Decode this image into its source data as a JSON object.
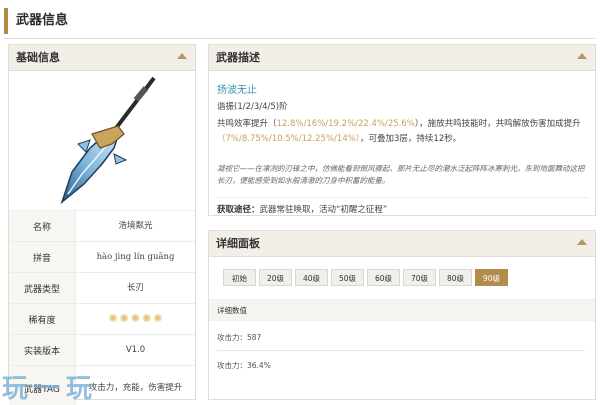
{
  "page": {
    "title": "武器信息"
  },
  "left_panel": {
    "header": "基础信息",
    "rows": [
      {
        "key": "名称",
        "value": "浩境粼光"
      },
      {
        "key": "拼音",
        "value": "hào jìng lín guāng"
      },
      {
        "key": "武器类型",
        "value": "长刃"
      },
      {
        "key": "稀有度",
        "stars": 5
      },
      {
        "key": "实装版本",
        "value": "V1.0"
      },
      {
        "key": "武器TAG",
        "value": "攻击力，充能，伤害提升"
      }
    ]
  },
  "desc_panel": {
    "header": "武器描述",
    "skill_name": "扬波无止",
    "resonance": "谐振(1/2/3/4/5)阶",
    "desc_p1": "共鸣效率提升（",
    "desc_v1": "12.8%/16%/19.2%/22.4%/25.6%",
    "desc_p2": "），施放共鸣技能时，共鸣解放伤害加成提升",
    "desc_v2": "（7%/8.75%/10.5%/12.25%/14%）",
    "desc_p3": "，可叠加3层，持续12秒。",
    "lore": "凝视它——在凛冽的刃锋之中，仿佛能看到倒风骤起、那片无止尽的潮水泛起阵阵冰寒刺光。东到地面舞动这把长刃，便能感受到如水般清澈的刀身中积蓄的能量。",
    "obtain_label": "获取途径：",
    "obtain_text": "武器常驻唤取，活动“初醒之征程”"
  },
  "detail_panel": {
    "header": "详细面板",
    "tabs": [
      "初始",
      "20级",
      "40级",
      "50级",
      "60级",
      "70级",
      "80级",
      "90级"
    ],
    "active_tab": "90级",
    "sub_header": "详细数值",
    "stats": [
      {
        "label": "攻击力：",
        "value": "587"
      },
      {
        "label": "攻击力：",
        "value": "36.4%"
      }
    ]
  },
  "watermark": "玩一玩",
  "colors": {
    "accent": "#b38c4c",
    "skill": "#3a8fb3",
    "highlight": "#c8a15a"
  }
}
